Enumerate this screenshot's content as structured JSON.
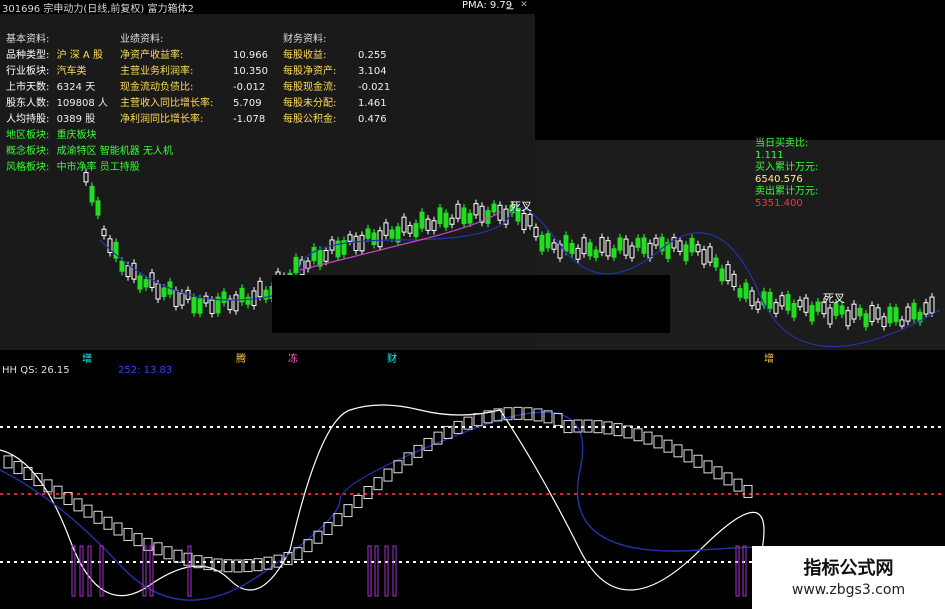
{
  "window": {
    "title": "301696 宗申动力(日线,前复权) 富力箱体2",
    "pma": "PMA: 9.79"
  },
  "basic_info": {
    "header": "基本资料:",
    "rows": [
      {
        "label": "品种类型:",
        "value": "沪 深 A 股"
      },
      {
        "label": "行业板块:",
        "value": "汽车类"
      },
      {
        "label": "上市天数:",
        "value": "6324 天"
      },
      {
        "label": "股东人数:",
        "value": "109808 人"
      },
      {
        "label": "人均持股:",
        "value": "0389 股"
      },
      {
        "label": "地区板块:",
        "value": "重庆板块"
      },
      {
        "label": "概念板块:",
        "value": "成渝特区 智能机器 无人机"
      },
      {
        "label": "风格板块:",
        "value": "中市净率 员工持股"
      }
    ]
  },
  "performance_info": {
    "header": "业绩资料:",
    "rows": [
      {
        "label": "净资产收益率:",
        "value": "10.966"
      },
      {
        "label": "主营业务利润率:",
        "value": "10.350"
      },
      {
        "label": "现金流动负债比:",
        "value": "-0.012"
      },
      {
        "label": "主营收入同比增长率:",
        "value": "5.709"
      },
      {
        "label": "净利润同比增长率:",
        "value": "-1.078"
      }
    ]
  },
  "financial_info": {
    "header": "财务资料:",
    "rows": [
      {
        "label": "每股收益:",
        "value": "0.255"
      },
      {
        "label": "每股净资产:",
        "value": "3.104"
      },
      {
        "label": "每股现金流:",
        "value": "-0.021"
      },
      {
        "label": "每股未分配:",
        "value": "1.461"
      },
      {
        "label": "每股公积金:",
        "value": "0.476"
      }
    ]
  },
  "trade_info": {
    "line1": "当日买卖比:",
    "line2": "1.111",
    "line3": "买入累计万元:",
    "line4": "6540.576",
    "line5": "卖出累计万元:",
    "line6": "5351.400"
  },
  "chart_labels": {
    "dead_cross_1": "死叉",
    "dead_cross_2": "死叉"
  },
  "event_markers": [
    {
      "label": "增",
      "color": "#00ffff"
    },
    {
      "label": "腾",
      "color": "#ffcc33"
    },
    {
      "label": "冻",
      "color": "#ff66cc"
    },
    {
      "label": "财",
      "color": "#00ffff"
    },
    {
      "label": "增",
      "color": "#ffcc33"
    }
  ],
  "indicator": {
    "label": "HH QS: 26.15",
    "label2": "252: 13.83"
  },
  "watermark": {
    "title": "指标公式网",
    "url": "www.zbgs3.com"
  }
}
